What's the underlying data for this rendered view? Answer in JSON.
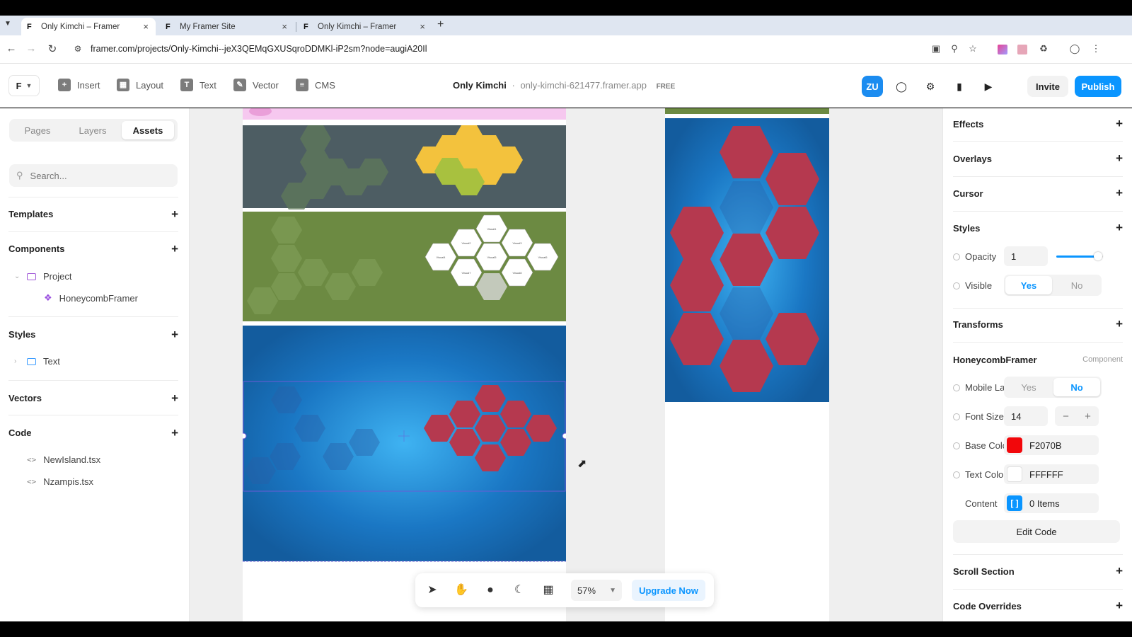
{
  "browser": {
    "tabs": [
      {
        "title": "Only Kimchi – Framer",
        "active": true
      },
      {
        "title": "My Framer Site",
        "active": false
      },
      {
        "title": "Only Kimchi – Framer",
        "active": false
      }
    ],
    "new_tab": "+",
    "url": "framer.com/projects/Only-Kimchi--jeX3QEMqGXUSqroDDMKl-iP2sm?node=augiA20Il"
  },
  "toolbar": {
    "items": [
      {
        "label": "Insert",
        "icon": "plus-square-icon"
      },
      {
        "label": "Layout",
        "icon": "layout-icon"
      },
      {
        "label": "Text",
        "icon": "text-icon"
      },
      {
        "label": "Vector",
        "icon": "vector-pen-icon"
      },
      {
        "label": "CMS",
        "icon": "database-icon"
      }
    ],
    "project_name": "Only Kimchi",
    "separator": "·",
    "domain": "only-kimchi-621477.framer.app",
    "plan_badge": "FREE",
    "avatar_initials": "ZU",
    "invite_label": "Invite",
    "publish_label": "Publish",
    "accent_color": "#0a95ff"
  },
  "left_panel": {
    "tabs": [
      "Pages",
      "Layers",
      "Assets"
    ],
    "active_tab": "Assets",
    "search_placeholder": "Search...",
    "sections": {
      "templates": "Templates",
      "components": "Components",
      "styles": "Styles",
      "vectors": "Vectors",
      "code": "Code"
    },
    "component_folder": "Project",
    "component_item": "HoneycombFramer",
    "style_folder": "Text",
    "code_files": [
      "NewIsland.tsx",
      "Nzampis.tsx"
    ]
  },
  "right_panel": {
    "effects": "Effects",
    "overlays": "Overlays",
    "cursor": "Cursor",
    "styles": "Styles",
    "opacity_label": "Opacity",
    "opacity_value": "1",
    "opacity_level": 0.9,
    "visible_label": "Visible",
    "visible_yes": "Yes",
    "visible_no": "No",
    "transforms": "Transforms",
    "component_title": "HoneycombFramer",
    "component_badge": "Component",
    "mobile_label": "Mobile La...",
    "mobile_yes": "Yes",
    "mobile_no": "No",
    "font_size_label": "Font Size",
    "font_size_value": "14",
    "base_color_label": "Base Color",
    "base_color_value": "F2070B",
    "base_color_hex": "#F2070B",
    "text_color_label": "Text Color",
    "text_color_value": "FFFFFF",
    "content_label": "Content",
    "content_value": "0 Items",
    "edit_code_label": "Edit Code",
    "scroll_section": "Scroll Section",
    "code_overrides": "Code Overrides"
  },
  "floating_bar": {
    "zoom": "57%",
    "upgrade_label": "Upgrade Now"
  },
  "canvas": {
    "honeycomb_text": [
      "Visual1",
      "Visual2",
      "Visual3",
      "Visual4",
      "Visual5",
      "Visual6",
      "Visual7",
      "Visual8",
      "Visual9",
      "Visual10"
    ],
    "colors": {
      "slate": "#4d5d63",
      "olive": "#6c8a42",
      "blue": "#1b78c8",
      "hex_red": "#b5394f",
      "hex_yellow": "#f3c23d",
      "hex_green": "#a8c13f"
    }
  }
}
